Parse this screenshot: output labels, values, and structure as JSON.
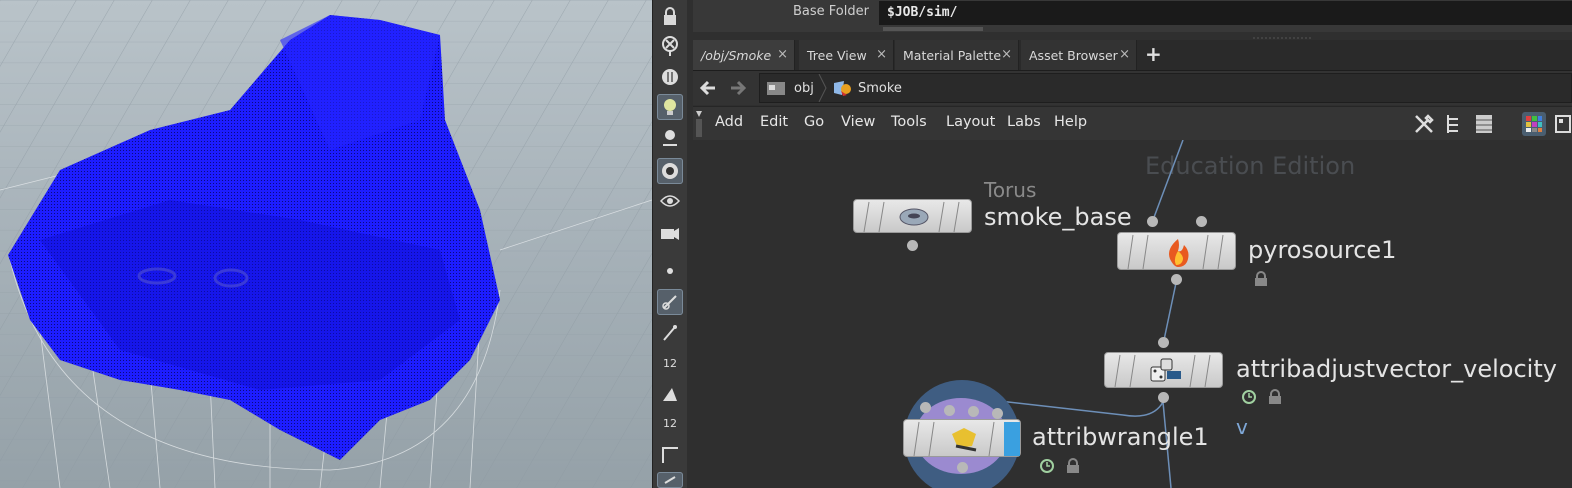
{
  "parm": {
    "label": "Base Folder",
    "value": "$JOB/sim/"
  },
  "tabs": [
    {
      "label": "/obj/Smoke",
      "close": "×"
    },
    {
      "label": "Tree View",
      "close": "×"
    },
    {
      "label": "Material Palette",
      "close": "×"
    },
    {
      "label": "Asset Browser",
      "close": "×"
    }
  ],
  "add_tab": "+",
  "path": {
    "root": "obj",
    "current": "Smoke"
  },
  "menu": [
    "Add",
    "Edit",
    "Go",
    "View",
    "Tools",
    "Layout",
    "Labs",
    "Help"
  ],
  "watermark": "Education Edition",
  "nodes": {
    "smoke_base": {
      "type": "Torus",
      "name": "smoke_base"
    },
    "pyrosource": {
      "name": "pyrosource1"
    },
    "attribadjust": {
      "name": "attribadjustvector_velocity",
      "subtitle": "v"
    },
    "attribwrangle": {
      "name": "attribwrangle1"
    }
  },
  "viewtools": {
    "counter1": "12",
    "counter2": "12"
  },
  "colors": {
    "points": "#1a1aff",
    "wire": "#6d8fb8",
    "pane": "#2f2f2f"
  }
}
